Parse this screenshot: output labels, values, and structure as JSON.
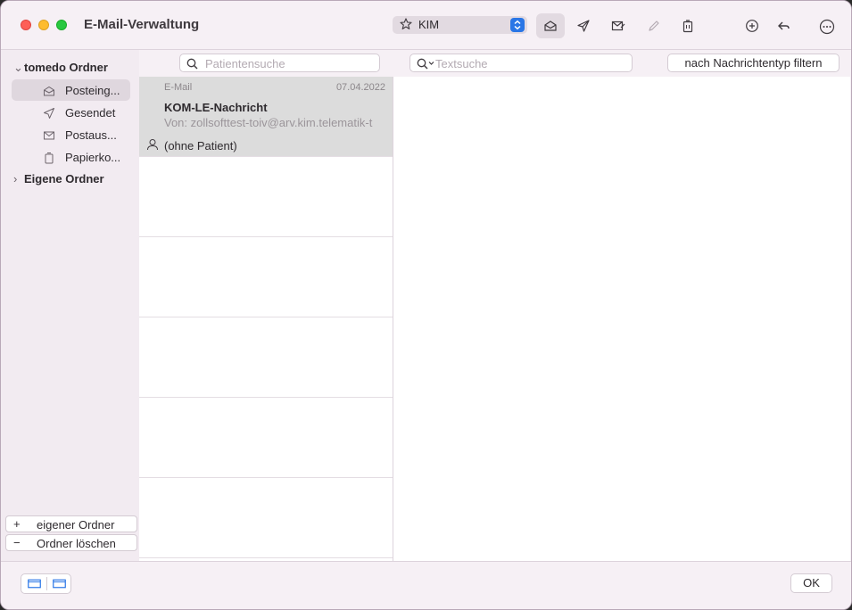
{
  "window": {
    "title": "E-Mail-Verwaltung"
  },
  "toolbar": {
    "mailbox_select": "KIM"
  },
  "sidebar": {
    "groups": [
      {
        "label": "tomedo Ordner",
        "expanded": true
      },
      {
        "label": "Eigene Ordner",
        "expanded": false
      }
    ],
    "items": [
      {
        "label": "Posteing...",
        "icon": "inbox-tray-icon",
        "selected": true
      },
      {
        "label": "Gesendet",
        "icon": "paper-plane-icon",
        "selected": false
      },
      {
        "label": "Postaus...",
        "icon": "envelope-icon",
        "selected": false
      },
      {
        "label": "Papierko...",
        "icon": "trash-icon",
        "selected": false
      }
    ],
    "add_folder": {
      "symbol": "+",
      "label": "eigener Ordner"
    },
    "delete_folder": {
      "symbol": "−",
      "label": "Ordner löschen"
    }
  },
  "search": {
    "patient_placeholder": "Patientensuche",
    "text_placeholder": "Textsuche",
    "filter_label": "nach Nachrichtentyp filtern"
  },
  "messages": [
    {
      "type": "E-Mail",
      "date": "07.04.2022",
      "subject": "KOM-LE-Nachricht",
      "from": "Von: zollsofttest-toiv@arv.kim.telematik-t",
      "patient": "(ohne Patient)"
    }
  ],
  "footer": {
    "ok_label": "OK"
  },
  "colors": {
    "accent": "#2a76e6",
    "selection": "#dcdcdc",
    "window_bg": "#f6f0f5"
  }
}
